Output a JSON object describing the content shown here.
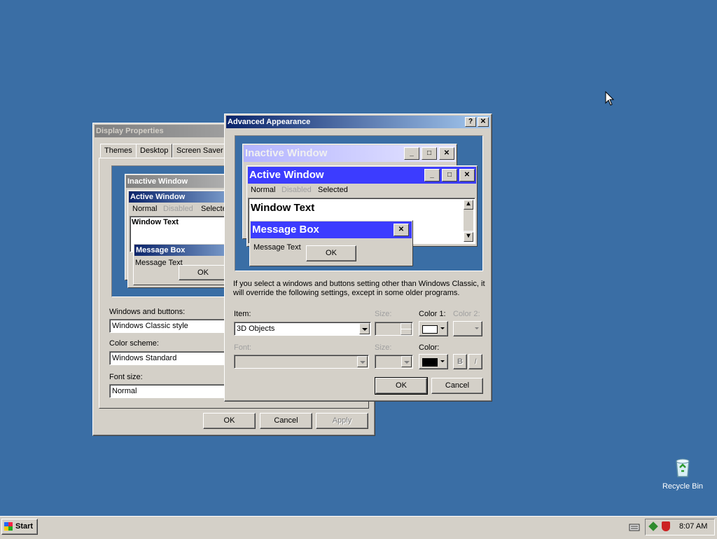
{
  "display_properties": {
    "title": "Display Properties",
    "tabs": [
      "Themes",
      "Desktop",
      "Screen Saver"
    ],
    "preview": {
      "inactive_title": "Inactive Window",
      "active_title": "Active Window",
      "menu_normal": "Normal",
      "menu_disabled": "Disabled",
      "menu_selected": "Selecte",
      "window_text": "Window Text",
      "message_box_title": "Message Box",
      "message_text": "Message Text",
      "ok": "OK"
    },
    "windows_buttons_label": "Windows and buttons:",
    "windows_buttons_value": "Windows Classic style",
    "color_scheme_label": "Color scheme:",
    "color_scheme_value": "Windows Standard",
    "font_size_label": "Font size:",
    "font_size_value": "Normal",
    "ok": "OK",
    "cancel": "Cancel",
    "apply": "Apply"
  },
  "advanced": {
    "title": "Advanced Appearance",
    "help_btn": "?",
    "close_btn": "✕",
    "preview": {
      "inactive_title": "Inactive Window",
      "active_title": "Active Window",
      "menu_normal": "Normal",
      "menu_disabled": "Disabled",
      "menu_selected": "Selected",
      "window_text": "Window Text",
      "message_box_title": "Message Box",
      "message_text": "Message Text",
      "ok": "OK"
    },
    "info_text": "If you select a windows and buttons setting other than Windows Classic, it will override the following settings, except in some older programs.",
    "item_label": "Item:",
    "item_value": "3D Objects",
    "size_label": "Size:",
    "color1_label": "Color 1:",
    "color2_label": "Color 2:",
    "font_label": "Font:",
    "font_size_label": "Size:",
    "font_color_label": "Color:",
    "bold_btn": "B",
    "italic_btn": "I",
    "ok": "OK",
    "cancel": "Cancel",
    "colors": {
      "color1": "#ffffff",
      "font_color": "#000000"
    }
  },
  "desktop": {
    "recycle_bin_label": "Recycle Bin"
  },
  "taskbar": {
    "start_label": "Start",
    "clock": "8:07 AM"
  },
  "colors": {
    "desktop": "#3a6ea5",
    "face": "#d4d0c8",
    "active_title": "#0a246a",
    "preview_active": "#3c3cff"
  }
}
